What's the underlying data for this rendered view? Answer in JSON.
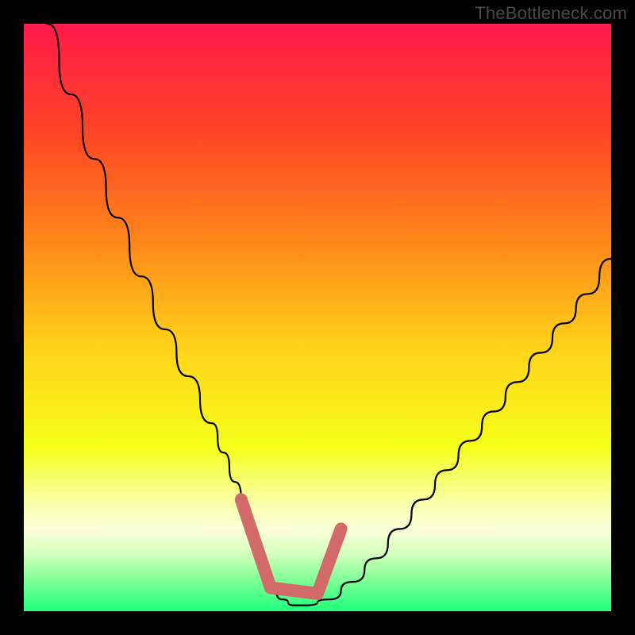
{
  "watermark": "TheBottleneck.com",
  "chart_data": {
    "type": "line",
    "title": "",
    "xlabel": "",
    "ylabel": "",
    "xlim": [
      0,
      100
    ],
    "ylim": [
      0,
      100
    ],
    "grid": false,
    "series": [
      {
        "name": "bottleneck-curve",
        "x": [
          4,
          8,
          12,
          16,
          20,
          24,
          28,
          32,
          34,
          36,
          38,
          40,
          42,
          44,
          46,
          48,
          52,
          56,
          60,
          64,
          68,
          72,
          76,
          80,
          84,
          88,
          92,
          96,
          100
        ],
        "y": [
          100,
          88,
          77,
          67,
          57,
          48,
          40,
          32,
          27,
          22,
          16,
          10,
          5,
          2,
          1,
          1,
          2,
          5,
          9,
          14,
          19,
          24,
          29,
          34,
          39,
          44,
          49,
          54,
          60
        ]
      }
    ],
    "highlight_segments": [
      {
        "name": "left-marker",
        "x": [
          37,
          42
        ],
        "y": [
          19,
          4
        ]
      },
      {
        "name": "bottom-marker",
        "x": [
          42,
          50
        ],
        "y": [
          4,
          3
        ]
      },
      {
        "name": "right-marker",
        "x": [
          50,
          54
        ],
        "y": [
          3,
          14
        ]
      }
    ],
    "gradient_stops": [
      {
        "offset": 0.0,
        "color": "#ff1a4b"
      },
      {
        "offset": 0.18,
        "color": "#ff4326"
      },
      {
        "offset": 0.38,
        "color": "#ff8a1a"
      },
      {
        "offset": 0.55,
        "color": "#ffd21a"
      },
      {
        "offset": 0.72,
        "color": "#f6ff1a"
      },
      {
        "offset": 0.82,
        "color": "#f8ffb0"
      },
      {
        "offset": 0.86,
        "color": "#fbffd8"
      },
      {
        "offset": 0.9,
        "color": "#d8ffc0"
      },
      {
        "offset": 0.94,
        "color": "#8cff9a"
      },
      {
        "offset": 1.0,
        "color": "#1fff7a"
      }
    ],
    "colors": {
      "curve": "#000000",
      "marker_stroke": "#d36a6a"
    }
  }
}
